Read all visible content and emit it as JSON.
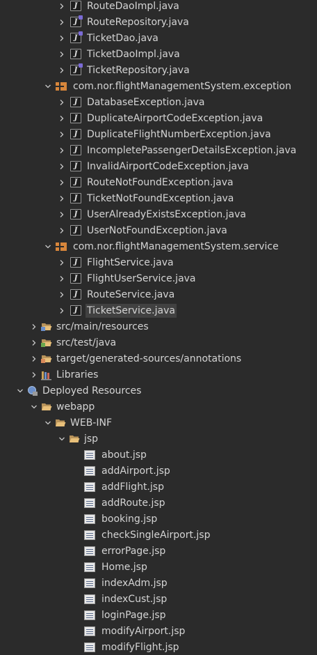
{
  "tree": {
    "rows": [
      {
        "label": "RouteDaoImpl.java",
        "level": 4,
        "twisty": "collapsed",
        "icon": "java-class-icon"
      },
      {
        "label": "RouteRepository.java",
        "level": 4,
        "twisty": "collapsed",
        "icon": "java-interface-icon"
      },
      {
        "label": "TicketDao.java",
        "level": 4,
        "twisty": "collapsed",
        "icon": "java-interface-icon"
      },
      {
        "label": "TicketDaoImpl.java",
        "level": 4,
        "twisty": "collapsed",
        "icon": "java-class-icon"
      },
      {
        "label": "TicketRepository.java",
        "level": 4,
        "twisty": "collapsed",
        "icon": "java-interface-icon"
      },
      {
        "label": "com.nor.flightManagementSystem.exception",
        "level": 3,
        "twisty": "expanded",
        "icon": "package-icon"
      },
      {
        "label": "DatabaseException.java",
        "level": 4,
        "twisty": "collapsed",
        "icon": "java-class-icon"
      },
      {
        "label": "DuplicateAirportCodeException.java",
        "level": 4,
        "twisty": "collapsed",
        "icon": "java-class-icon"
      },
      {
        "label": "DuplicateFlightNumberException.java",
        "level": 4,
        "twisty": "collapsed",
        "icon": "java-class-icon"
      },
      {
        "label": "IncompletePassengerDetailsException.java",
        "level": 4,
        "twisty": "collapsed",
        "icon": "java-class-icon"
      },
      {
        "label": "InvalidAirportCodeException.java",
        "level": 4,
        "twisty": "collapsed",
        "icon": "java-class-icon"
      },
      {
        "label": "RouteNotFoundException.java",
        "level": 4,
        "twisty": "collapsed",
        "icon": "java-class-icon"
      },
      {
        "label": "TicketNotFoundException.java",
        "level": 4,
        "twisty": "collapsed",
        "icon": "java-class-icon"
      },
      {
        "label": "UserAlreadyExistsException.java",
        "level": 4,
        "twisty": "collapsed",
        "icon": "java-class-icon"
      },
      {
        "label": "UserNotFoundException.java",
        "level": 4,
        "twisty": "collapsed",
        "icon": "java-class-icon"
      },
      {
        "label": "com.nor.flightManagementSystem.service",
        "level": 3,
        "twisty": "expanded",
        "icon": "package-icon"
      },
      {
        "label": "FlightService.java",
        "level": 4,
        "twisty": "collapsed",
        "icon": "java-class-icon"
      },
      {
        "label": "FlightUserService.java",
        "level": 4,
        "twisty": "collapsed",
        "icon": "java-class-icon"
      },
      {
        "label": "RouteService.java",
        "level": 4,
        "twisty": "collapsed",
        "icon": "java-class-icon"
      },
      {
        "label": "TicketService.java",
        "level": 4,
        "twisty": "collapsed",
        "icon": "java-class-icon",
        "selected": true
      },
      {
        "label": "src/main/resources",
        "level": 2,
        "twisty": "collapsed",
        "icon": "source-folder-icon"
      },
      {
        "label": "src/test/java",
        "level": 2,
        "twisty": "collapsed",
        "icon": "source-folder-java-icon"
      },
      {
        "label": "target/generated-sources/annotations",
        "level": 2,
        "twisty": "collapsed",
        "icon": "source-folder-generated-icon"
      },
      {
        "label": "Libraries",
        "level": 2,
        "twisty": "collapsed",
        "icon": "libraries-icon"
      },
      {
        "label": "Deployed Resources",
        "level": 1,
        "twisty": "expanded",
        "icon": "deployed-resources-icon"
      },
      {
        "label": "webapp",
        "level": 2,
        "twisty": "expanded",
        "icon": "folder-open-icon"
      },
      {
        "label": "WEB-INF",
        "level": 3,
        "twisty": "expanded",
        "icon": "folder-open-icon"
      },
      {
        "label": "jsp",
        "level": 4,
        "twisty": "expanded",
        "icon": "folder-open-icon"
      },
      {
        "label": "about.jsp",
        "level": 5,
        "twisty": "none",
        "icon": "jsp-file-icon"
      },
      {
        "label": "addAirport.jsp",
        "level": 5,
        "twisty": "none",
        "icon": "jsp-file-icon"
      },
      {
        "label": "addFlight.jsp",
        "level": 5,
        "twisty": "none",
        "icon": "jsp-file-icon"
      },
      {
        "label": "addRoute.jsp",
        "level": 5,
        "twisty": "none",
        "icon": "jsp-file-icon"
      },
      {
        "label": "booking.jsp",
        "level": 5,
        "twisty": "none",
        "icon": "jsp-file-icon"
      },
      {
        "label": "checkSingleAirport.jsp",
        "level": 5,
        "twisty": "none",
        "icon": "jsp-file-icon"
      },
      {
        "label": "errorPage.jsp",
        "level": 5,
        "twisty": "none",
        "icon": "jsp-file-icon"
      },
      {
        "label": "Home.jsp",
        "level": 5,
        "twisty": "none",
        "icon": "jsp-file-icon"
      },
      {
        "label": "indexAdm.jsp",
        "level": 5,
        "twisty": "none",
        "icon": "jsp-file-icon"
      },
      {
        "label": "indexCust.jsp",
        "level": 5,
        "twisty": "none",
        "icon": "jsp-file-icon"
      },
      {
        "label": "loginPage.jsp",
        "level": 5,
        "twisty": "none",
        "icon": "jsp-file-icon"
      },
      {
        "label": "modifyAirport.jsp",
        "level": 5,
        "twisty": "none",
        "icon": "jsp-file-icon"
      },
      {
        "label": "modifyFlight.jsp",
        "level": 5,
        "twisty": "none",
        "icon": "jsp-file-icon"
      }
    ]
  },
  "colors": {
    "background": "#2b2b2b",
    "text": "#d4d4d4",
    "selection": "#414141",
    "package": "#d8863b",
    "folder": "#e8c07a",
    "twisty": "#c8c8c8"
  }
}
